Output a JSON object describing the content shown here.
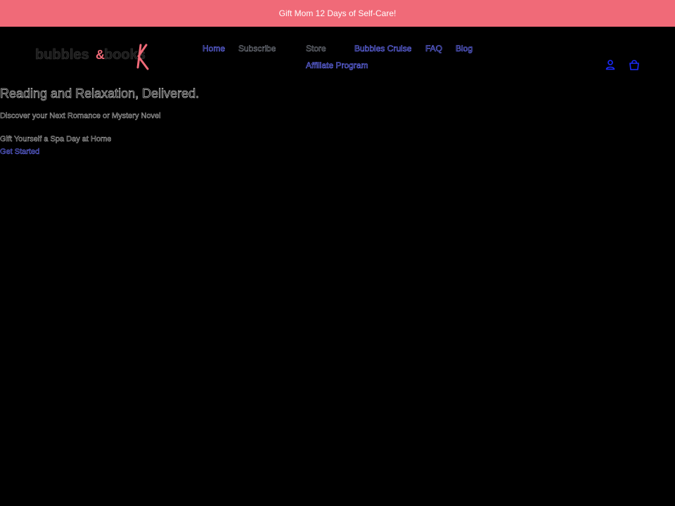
{
  "announcement": {
    "text": "Gift Mom 12 Days of Self-Care!"
  },
  "header": {
    "logo": {
      "word1": "bubbles",
      "amp": "&",
      "word2": "books",
      "colors": {
        "text": "#1a1a1a",
        "accent": "#f06a78"
      }
    },
    "nav": {
      "home": "Home",
      "subscribe": "Subscribe",
      "store": "Store",
      "cruise": "Bubbles Cruise",
      "faq": "FAQ",
      "blog": "Blog",
      "affiliate": "Affiliate Program"
    },
    "icons": {
      "account": "account-icon",
      "cart": "cart-icon"
    }
  },
  "hero": {
    "title": "Reading and Relaxation, Delivered.",
    "subtitle": "Discover your Next Romance or Mystery Novel",
    "tagline": "Gift Yourself a Spa Day at Home",
    "cta": "Get Started"
  },
  "colors": {
    "background": "#000000",
    "announcement_bg": "#f06a78",
    "link": "#6b72ff",
    "icon": "#1a2bff"
  }
}
